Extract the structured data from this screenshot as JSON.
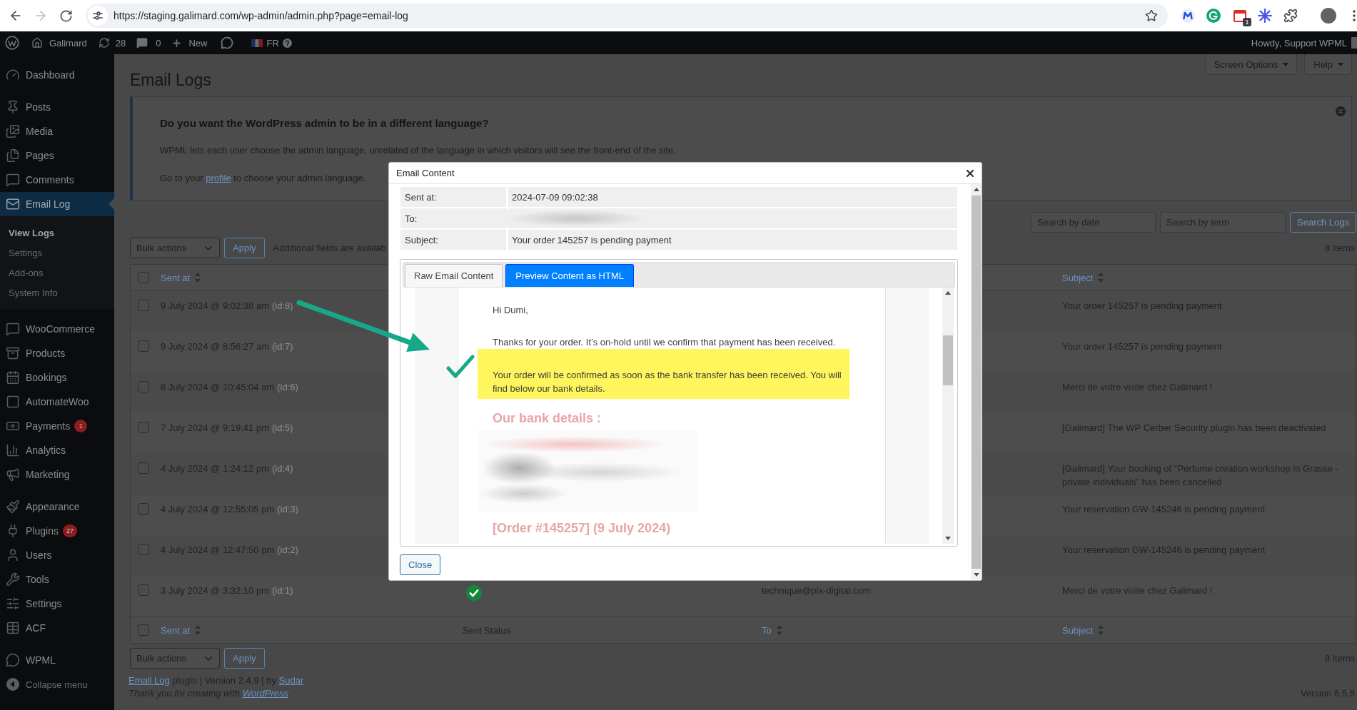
{
  "browser": {
    "forward_disabled": true,
    "url": "https://staging.galimard.com/wp-admin/admin.php?page=email-log",
    "extension_badge": "1"
  },
  "admin_bar": {
    "site": "Galimard",
    "updates": "28",
    "comments": "0",
    "new": "New",
    "language": "FR",
    "greeting": "Howdy, Support WPML"
  },
  "sidebar": {
    "groups": [
      [
        {
          "label": "Dashboard",
          "selected": false
        }
      ],
      [
        {
          "label": "Posts",
          "selected": false
        },
        {
          "label": "Media",
          "selected": false
        },
        {
          "label": "Pages",
          "selected": false
        },
        {
          "label": "Comments",
          "selected": false
        },
        {
          "label": "Email Log",
          "selected": true,
          "children": [
            {
              "label": "View Logs",
              "selected": true
            },
            {
              "label": "Settings",
              "selected": false
            },
            {
              "label": "Add-ons",
              "selected": false
            },
            {
              "label": "System Info",
              "selected": false
            }
          ]
        }
      ],
      [
        {
          "label": "WooCommerce",
          "selected": false
        },
        {
          "label": "Products",
          "selected": false
        },
        {
          "label": "Bookings",
          "selected": false
        },
        {
          "label": "AutomateWoo",
          "selected": false
        },
        {
          "label": "Payments",
          "selected": false,
          "badge": "1"
        },
        {
          "label": "Analytics",
          "selected": false
        },
        {
          "label": "Marketing",
          "selected": false
        }
      ],
      [
        {
          "label": "Appearance",
          "selected": false
        },
        {
          "label": "Plugins",
          "selected": false,
          "badge": "27"
        },
        {
          "label": "Users",
          "selected": false
        },
        {
          "label": "Tools",
          "selected": false
        },
        {
          "label": "Settings",
          "selected": false
        },
        {
          "label": "ACF",
          "selected": false
        }
      ],
      [
        {
          "label": "WPML",
          "selected": false
        }
      ]
    ],
    "collapse": "Collapse menu"
  },
  "screen_meta": [
    {
      "label": "Screen Options"
    },
    {
      "label": "Help"
    }
  ],
  "page": {
    "title": "Email Logs"
  },
  "notice": {
    "heading": "Do you want the WordPress admin to be in a different language?",
    "text": "WPML lets each user choose the admin language, unrelated of the language in which visitors will see the front-end of the site.",
    "link_line": {
      "before": "Go to your ",
      "link": "profile",
      "after": " to choose your admin language."
    }
  },
  "search": {
    "date_placeholder": "Search by date",
    "term_placeholder": "Search by term",
    "button": "Search Logs"
  },
  "tablenav_top": {
    "bulk_actions": "Bulk actions",
    "apply": "Apply",
    "note": "Additional fields are availab",
    "count": "8 items"
  },
  "table": {
    "header": {
      "select_all": {
        "checked": false
      },
      "sent_at": {
        "label": "Sent at",
        "sortable": true
      },
      "subject": {
        "label": "Subject",
        "sortable": true
      }
    },
    "rows": [
      {
        "checked": false,
        "sent_at": "9 July 2024 @ 9:02:38 am",
        "id": "(id:8)",
        "subject": "Your order 145257 is pending payment"
      },
      {
        "checked": false,
        "sent_at": "9 July 2024 @ 8:56:27 am",
        "id": "(id:7)",
        "subject": "Your order 145257 is pending payment"
      },
      {
        "checked": false,
        "sent_at": "8 July 2024 @ 10:45:04 am",
        "id": "(id:6)",
        "subject": "Merci de votre visite chez Galimard !"
      },
      {
        "checked": false,
        "sent_at": "7 July 2024 @ 9:19:41 pm",
        "id": "(id:5)",
        "subject": "[Galimard] The WP Cerber Security plugin has been deactivated"
      },
      {
        "checked": false,
        "sent_at": "4 July 2024 @ 1:24:12 pm",
        "id": "(id:4)",
        "subject": "[Galimard] Your booking of \"Perfume creation workshop in Grasse - private individuals\" has been cancelled"
      },
      {
        "checked": false,
        "sent_at": "4 July 2024 @ 12:55:05 pm",
        "id": "(id:3)",
        "subject": "Your reservation GW-145246 is pending payment"
      },
      {
        "checked": false,
        "sent_at": "4 July 2024 @ 12:47:50 pm",
        "id": "(id:2)",
        "subject": "Your reservation GW-145246 is pending payment"
      },
      {
        "checked": false,
        "sent_at": "3 July 2024 @ 3:32:10 pm",
        "id": "(id:1)",
        "sent": true,
        "to": "technique@pix-digital.com",
        "subject": "Merci de votre visite chez Galimard !"
      }
    ],
    "footer": {
      "select_all": {
        "checked": false
      },
      "sent_at": {
        "label": "Sent at",
        "sortable": true
      },
      "sent_status": {
        "label": "Sent Status",
        "sortable": false
      },
      "to": {
        "label": "To",
        "sortable": true
      },
      "subject": {
        "label": "Subject",
        "sortable": true
      }
    }
  },
  "tablenav_bottom": {
    "bulk_actions": "Bulk actions",
    "apply": "Apply",
    "count": "8 items"
  },
  "footer": {
    "credit": {
      "plugin_link": "Email Log",
      "middle": " plugin | Version 2.4.9 | by ",
      "author_link": "Sudar"
    },
    "thanks": {
      "before": "Thank you for creating with ",
      "link": "WordPress",
      "after": "."
    },
    "version": "Version 6.5.5"
  },
  "dialog": {
    "title": "Email Content",
    "meta": [
      {
        "label": "Sent at:",
        "value": "2024-07-09 09:02:38"
      },
      {
        "label": "To:",
        "blurred": true
      },
      {
        "label": "Subject:",
        "value": "Your order 145257 is pending payment"
      }
    ],
    "tabs": [
      {
        "label": "Raw Email Content",
        "selected": false
      },
      {
        "label": "Preview Content as HTML",
        "selected": true
      }
    ],
    "email": {
      "paragraphs": [
        {
          "text": "Hi Dumi,",
          "highlighted": false
        },
        {
          "text": "Thanks for your order. It’s on-hold until we confirm that payment has been received.",
          "highlighted": false
        },
        {
          "text": "Your order will be confirmed as soon as the bank transfer has been received. You will find below our bank details.",
          "highlighted": true
        }
      ],
      "bank_heading": "Our bank details :",
      "bank_details_blurred": true,
      "order_heading": "[Order #145257] (9 July 2024)"
    },
    "close": "Close"
  }
}
